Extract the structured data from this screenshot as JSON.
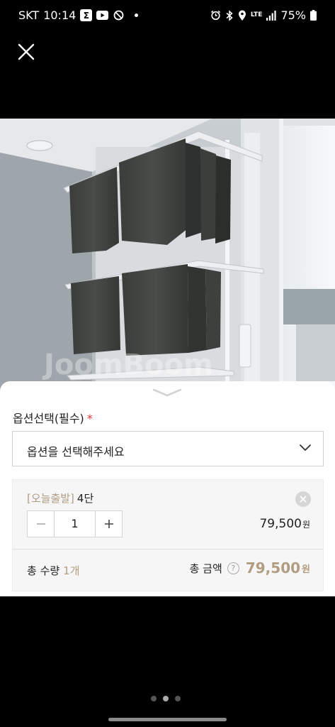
{
  "status_bar": {
    "carrier": "SKT",
    "time": "10:14",
    "network": "LTE",
    "battery": "75%",
    "icons": [
      "sigma-app-icon",
      "youtube-icon",
      "do-not-disturb-icon",
      "alarm-icon",
      "bluetooth-icon",
      "location-icon",
      "signal-icon",
      "battery-icon"
    ]
  },
  "product_image": {
    "watermark": "JoomBoom"
  },
  "option_sheet": {
    "label": "옵션선택(필수)",
    "required_mark": "*",
    "select_placeholder": "옵션을 선택해주세요",
    "selected_item": {
      "tag": "[오늘출발]",
      "name": "4단",
      "quantity": "1",
      "price": "79,500",
      "currency": "원"
    },
    "total": {
      "qty_label": "총 수량",
      "qty_value": "1개",
      "amount_label": "총 금액",
      "help_symbol": "?",
      "amount_value": "79,500",
      "currency": "원"
    }
  },
  "colors": {
    "accent": "#b19d82",
    "required": "#d33333",
    "panel_bg": "#f6f6f6"
  },
  "pager": {
    "count": 3,
    "active_index": 1
  }
}
